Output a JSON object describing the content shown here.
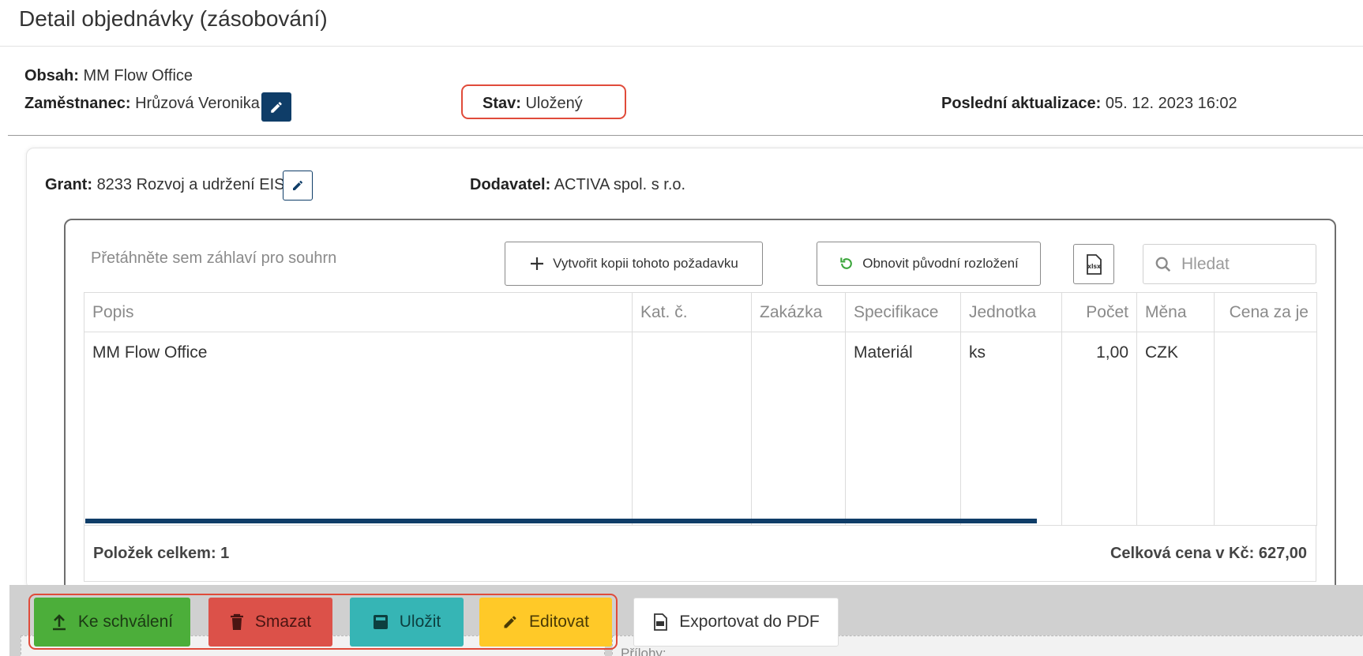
{
  "page": {
    "title": "Detail objednávky (zásobování)"
  },
  "header": {
    "obsah_label": "Obsah:",
    "obsah_value": "MM Flow Office",
    "employee_label": "Zaměstnanec:",
    "employee_value": "Hrůzová Veronika",
    "stav_label": "Stav:",
    "stav_value": "Uložený",
    "last_update_label": "Poslední aktualizace:",
    "last_update_value": "05. 12. 2023 16:02"
  },
  "detail": {
    "grant_label": "Grant:",
    "grant_value": "8233 Rozvoj a udržení EIS",
    "supplier_label": "Dodavatel:",
    "supplier_value": "ACTIVA spol. s r.o."
  },
  "grid": {
    "group_hint": "Přetáhněte sem záhlaví pro souhrn",
    "copy_button": "Vytvořit kopii tohoto požadavku",
    "reset_button": "Obnovit původní rozložení",
    "xlsx_icon_label": "xlsx",
    "search_placeholder": "Hledat",
    "columns": [
      "Popis",
      "Kat. č.",
      "Zakázka",
      "Specifikace",
      "Jednotka",
      "Počet",
      "Měna",
      "Cena za je"
    ],
    "rows": [
      [
        "MM Flow Office",
        "",
        "",
        "Materiál",
        "ks",
        "1,00",
        "CZK",
        ""
      ]
    ],
    "footer_count": "Položek celkem: 1",
    "footer_total": "Celková cena v Kč: 627,00"
  },
  "actions": {
    "approve": "Ke schválení",
    "delete": "Smazat",
    "save": "Uložit",
    "edit": "Editovat",
    "export_pdf": "Exportovat do PDF"
  },
  "bottom": {
    "attachments_label": "Přílohy:"
  },
  "icons": [
    "pencil-icon",
    "plus-icon",
    "refresh-icon",
    "xlsx-icon",
    "search-icon",
    "upload-icon",
    "trash-icon",
    "save-icon",
    "pdf-icon"
  ]
}
